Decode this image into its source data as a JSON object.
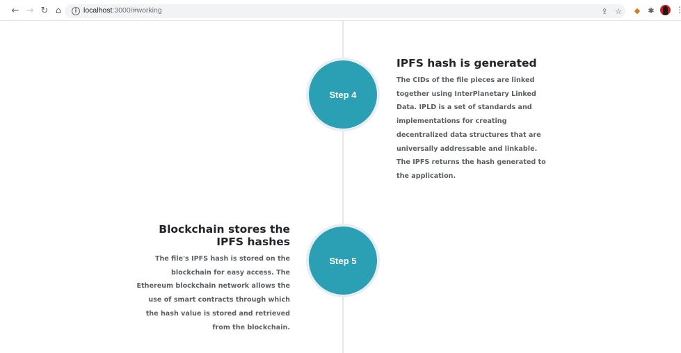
{
  "browser": {
    "url_host": "localhost",
    "url_rest": ":3000/#working"
  },
  "timeline": {
    "steps": [
      {
        "label": "Step 4",
        "title": "IPFS hash is generated",
        "description": "The CIDs of the file pieces are linked together using InterPlanetary Linked Data. IPLD is a set of standards and implementations for creating decentralized data structures that are universally addressable and linkable. The IPFS returns the hash generated to the application."
      },
      {
        "label": "Step 5",
        "title": "Blockchain stores the IPFS hashes",
        "description": "The file's IPFS hash is stored on the blockchain for easy access. The Ethereum blockchain network allows the use of smart contracts through which the hash value is stored and retrieved from the blockchain."
      }
    ]
  },
  "colors": {
    "step_circle": "#2b9fb3",
    "timeline_line": "#e3e7ea"
  }
}
